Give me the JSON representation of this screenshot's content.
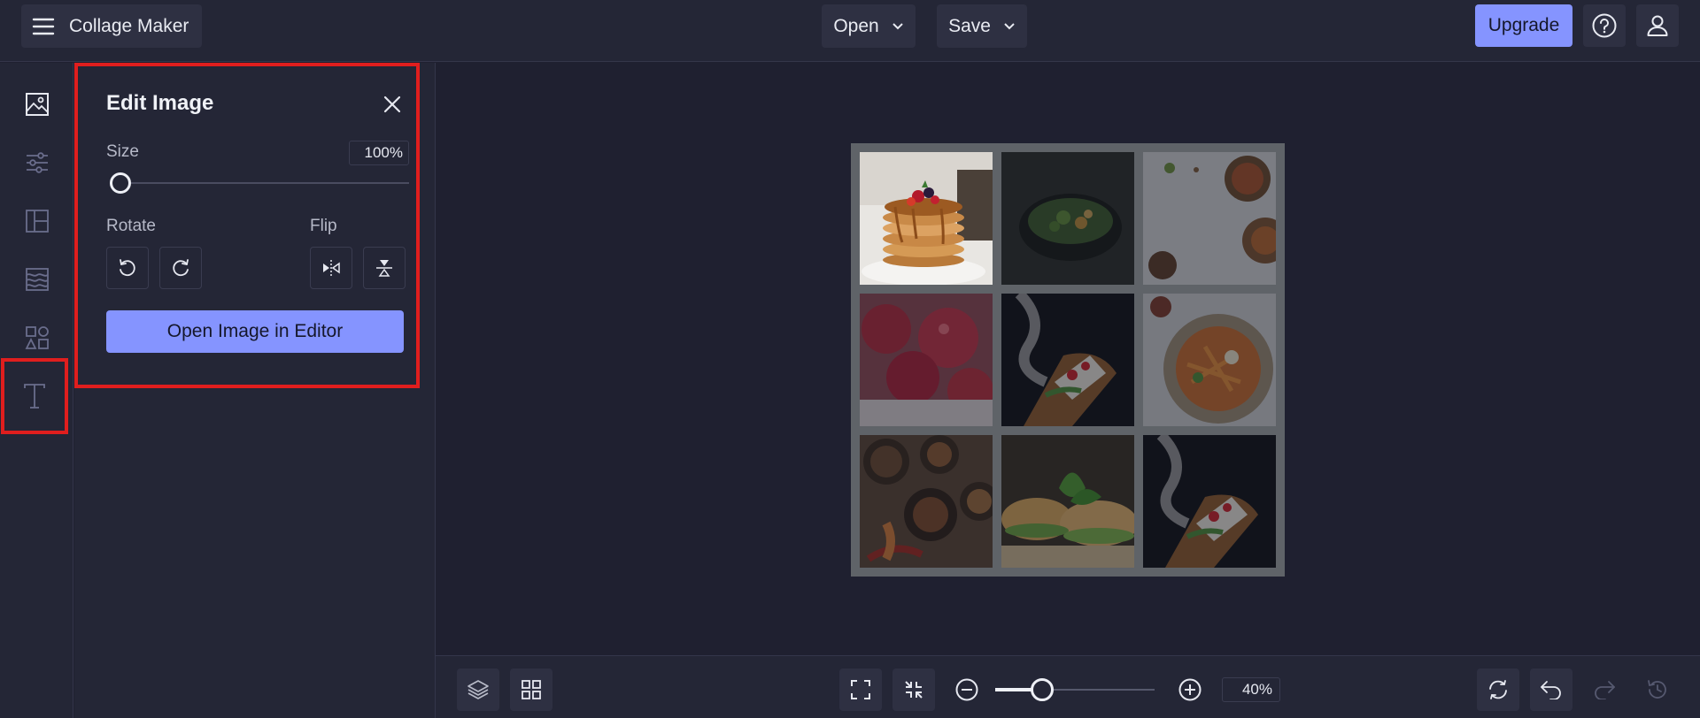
{
  "header": {
    "app_title": "Collage Maker",
    "open_label": "Open",
    "save_label": "Save",
    "upgrade_label": "Upgrade"
  },
  "rail": {
    "items": [
      "image-icon",
      "adjustments-icon",
      "layout-icon",
      "texture-icon",
      "shapes-icon",
      "text-icon"
    ],
    "active": "text-icon"
  },
  "edit_panel": {
    "title": "Edit Image",
    "size_label": "Size",
    "size_value": "100%",
    "size_level": 0,
    "rotate_label": "Rotate",
    "flip_label": "Flip",
    "open_editor_label": "Open Image in Editor"
  },
  "zoom": {
    "value": "40%",
    "level": 0.3
  },
  "colors": {
    "accent": "#8594ff",
    "background": "#1f2030",
    "panel": "#242636",
    "highlight": "#e01e1e",
    "collage_border": "#5f6368"
  }
}
